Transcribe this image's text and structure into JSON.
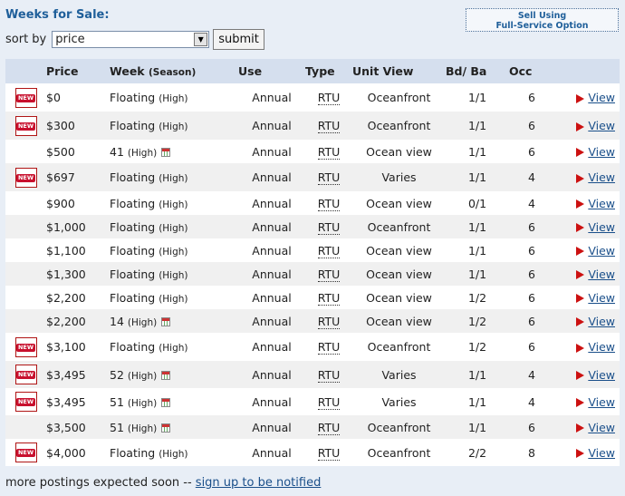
{
  "header": {
    "title": "Weeks for Sale:",
    "sell_line1": "Sell Using",
    "sell_line2": "Full-Service Option"
  },
  "sort": {
    "label": "sort by",
    "selected": "price",
    "submit_label": "submit"
  },
  "table": {
    "columns": {
      "price": "Price",
      "week": "Week",
      "week_sub": "(Season)",
      "use": "Use",
      "type": "Type",
      "unit_view": "Unit View",
      "bdba": "Bd/ Ba",
      "occ": "Occ"
    },
    "new_badge_text": "NEW",
    "view_label": "View",
    "rows": [
      {
        "new": true,
        "price": "$0",
        "week": "Floating",
        "season": "(High)",
        "calendar": false,
        "use": "Annual",
        "type": "RTU",
        "view": "Oceanfront",
        "bdba": "1/1",
        "occ": "6"
      },
      {
        "new": true,
        "price": "$300",
        "week": "Floating",
        "season": "(High)",
        "calendar": false,
        "use": "Annual",
        "type": "RTU",
        "view": "Oceanfront",
        "bdba": "1/1",
        "occ": "6"
      },
      {
        "new": false,
        "price": "$500",
        "week": "41",
        "season": "(High)",
        "calendar": true,
        "use": "Annual",
        "type": "RTU",
        "view": "Ocean view",
        "bdba": "1/1",
        "occ": "6"
      },
      {
        "new": true,
        "price": "$697",
        "week": "Floating",
        "season": "(High)",
        "calendar": false,
        "use": "Annual",
        "type": "RTU",
        "view": "Varies",
        "bdba": "1/1",
        "occ": "4"
      },
      {
        "new": false,
        "price": "$900",
        "week": "Floating",
        "season": "(High)",
        "calendar": false,
        "use": "Annual",
        "type": "RTU",
        "view": "Ocean view",
        "bdba": "0/1",
        "occ": "4"
      },
      {
        "new": false,
        "price": "$1,000",
        "week": "Floating",
        "season": "(High)",
        "calendar": false,
        "use": "Annual",
        "type": "RTU",
        "view": "Oceanfront",
        "bdba": "1/1",
        "occ": "6"
      },
      {
        "new": false,
        "price": "$1,100",
        "week": "Floating",
        "season": "(High)",
        "calendar": false,
        "use": "Annual",
        "type": "RTU",
        "view": "Ocean view",
        "bdba": "1/1",
        "occ": "6"
      },
      {
        "new": false,
        "price": "$1,300",
        "week": "Floating",
        "season": "(High)",
        "calendar": false,
        "use": "Annual",
        "type": "RTU",
        "view": "Ocean view",
        "bdba": "1/1",
        "occ": "6"
      },
      {
        "new": false,
        "price": "$2,200",
        "week": "Floating",
        "season": "(High)",
        "calendar": false,
        "use": "Annual",
        "type": "RTU",
        "view": "Ocean view",
        "bdba": "1/2",
        "occ": "6"
      },
      {
        "new": false,
        "price": "$2,200",
        "week": "14",
        "season": "(High)",
        "calendar": true,
        "use": "Annual",
        "type": "RTU",
        "view": "Ocean view",
        "bdba": "1/2",
        "occ": "6"
      },
      {
        "new": true,
        "price": "$3,100",
        "week": "Floating",
        "season": "(High)",
        "calendar": false,
        "use": "Annual",
        "type": "RTU",
        "view": "Oceanfront",
        "bdba": "1/2",
        "occ": "6"
      },
      {
        "new": true,
        "price": "$3,495",
        "week": "52",
        "season": "(High)",
        "calendar": true,
        "use": "Annual",
        "type": "RTU",
        "view": "Varies",
        "bdba": "1/1",
        "occ": "4"
      },
      {
        "new": true,
        "price": "$3,495",
        "week": "51",
        "season": "(High)",
        "calendar": true,
        "use": "Annual",
        "type": "RTU",
        "view": "Varies",
        "bdba": "1/1",
        "occ": "4"
      },
      {
        "new": false,
        "price": "$3,500",
        "week": "51",
        "season": "(High)",
        "calendar": true,
        "use": "Annual",
        "type": "RTU",
        "view": "Oceanfront",
        "bdba": "1/1",
        "occ": "6"
      },
      {
        "new": true,
        "price": "$4,000",
        "week": "Floating",
        "season": "(High)",
        "calendar": false,
        "use": "Annual",
        "type": "RTU",
        "view": "Oceanfront",
        "bdba": "2/2",
        "occ": "8"
      }
    ]
  },
  "footer": {
    "text": "more postings expected soon -- ",
    "link": "sign up to be notified"
  }
}
